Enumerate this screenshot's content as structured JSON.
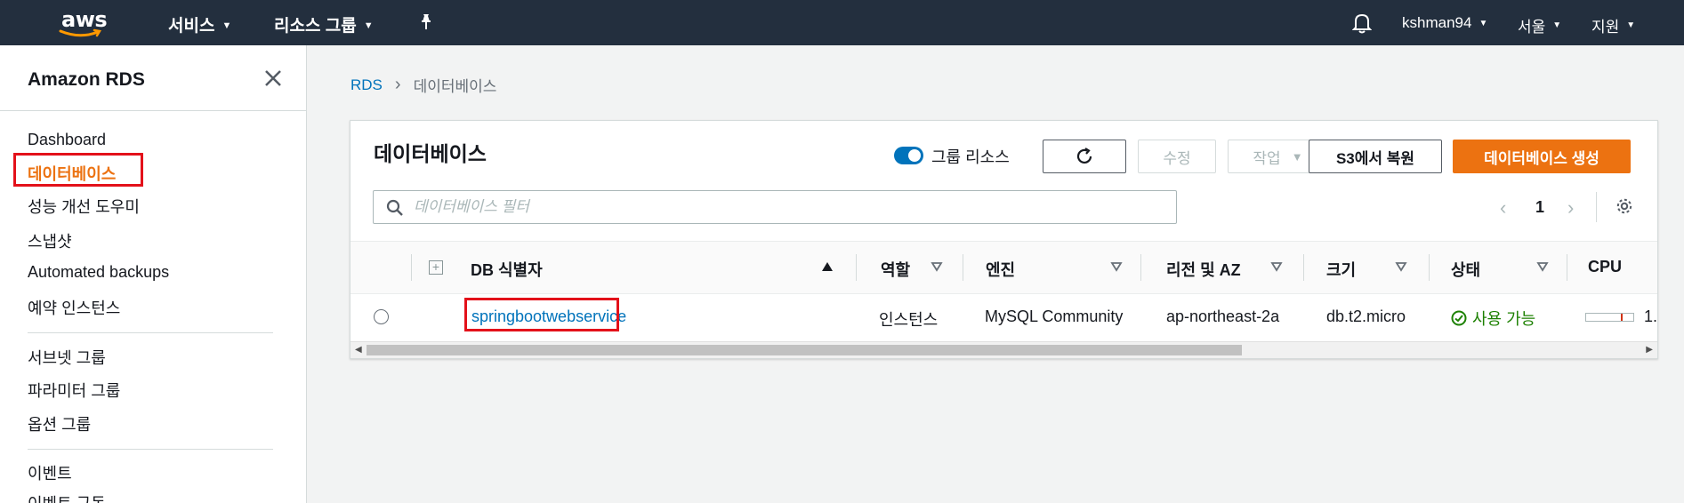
{
  "topnav": {
    "logo": "aws",
    "services": "서비스",
    "resource_groups": "리소스 그룹",
    "user": "kshman94",
    "region": "서울",
    "support": "지원"
  },
  "sidebar": {
    "title": "Amazon RDS",
    "items": [
      {
        "label": "Dashboard"
      },
      {
        "label": "데이터베이스"
      },
      {
        "label": "성능 개선 도우미"
      },
      {
        "label": "스냅샷"
      },
      {
        "label": "Automated backups"
      },
      {
        "label": "예약 인스턴스"
      },
      {
        "label": "서브넷 그룹"
      },
      {
        "label": "파라미터 그룹"
      },
      {
        "label": "옵션 그룹"
      },
      {
        "label": "이벤트"
      },
      {
        "label": "이벤트 구독"
      }
    ]
  },
  "breadcrumb": {
    "root": "RDS",
    "current": "데이터베이스"
  },
  "panel": {
    "title": "데이터베이스",
    "group_toggle_label": "그룹 리소스",
    "btn_modify": "수정",
    "btn_actions": "작업",
    "btn_restore_s3": "S3에서 복원",
    "btn_create": "데이터베이스 생성",
    "search_placeholder": "데이터베이스 필터",
    "page": "1"
  },
  "table": {
    "headers": {
      "db_id": "DB 식별자",
      "role": "역할",
      "engine": "엔진",
      "region_az": "리전 및 AZ",
      "size": "크기",
      "status": "상태",
      "cpu": "CPU"
    },
    "rows": [
      {
        "db_id": "springbootwebservice",
        "role": "인스턴스",
        "engine": "MySQL Community",
        "region_az": "ap-northeast-2a",
        "size": "db.t2.micro",
        "status": "사용 가능",
        "cpu": "1."
      }
    ]
  },
  "colors": {
    "nav_bg": "#232f3e",
    "accent_orange": "#ec7211",
    "link_blue": "#0073bb",
    "status_green": "#1d8102",
    "highlight_red": "#e3111a"
  }
}
